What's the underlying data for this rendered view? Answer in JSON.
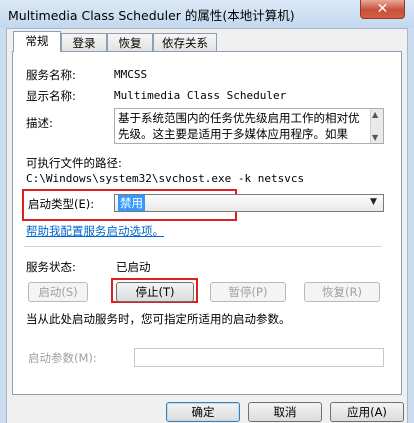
{
  "window": {
    "title": "Multimedia Class Scheduler 的属性(本地计算机)",
    "close_glyph": "✕"
  },
  "tabs": [
    {
      "label": "常规",
      "active": true
    },
    {
      "label": "登录",
      "active": false
    },
    {
      "label": "恢复",
      "active": false
    },
    {
      "label": "依存关系",
      "active": false
    }
  ],
  "general": {
    "service_name_label": "服务名称:",
    "service_name": "MMCSS",
    "display_name_label": "显示名称:",
    "display_name": "Multimedia Class Scheduler",
    "description_label": "描述:",
    "description": "基于系统范围内的任务优先级启用工作的相对优先级。这主要是适用于多媒体应用程序。如果",
    "path_label": "可执行文件的路径:",
    "path": "C:\\Windows\\system32\\svchost.exe -k netsvcs",
    "startup_type_label": "启动类型(E):",
    "startup_type_value": "禁用",
    "help_link": "帮助我配置服务启动选项。",
    "status_label": "服务状态:",
    "status_value": "已启动",
    "start_button": "启动(S)",
    "stop_button": "停止(T)",
    "pause_button": "暂停(P)",
    "resume_button": "恢复(R)",
    "start_hint": "当从此处启动服务时，您可指定所适用的启动参数。",
    "start_params_label": "启动参数(M):",
    "start_params_value": ""
  },
  "footer": {
    "ok_button": "确定",
    "cancel_button": "取消",
    "apply_button": "应用(A)"
  },
  "colors": {
    "highlight_box": "#e02020",
    "selection": "#3399ff",
    "link": "#0066cc"
  }
}
